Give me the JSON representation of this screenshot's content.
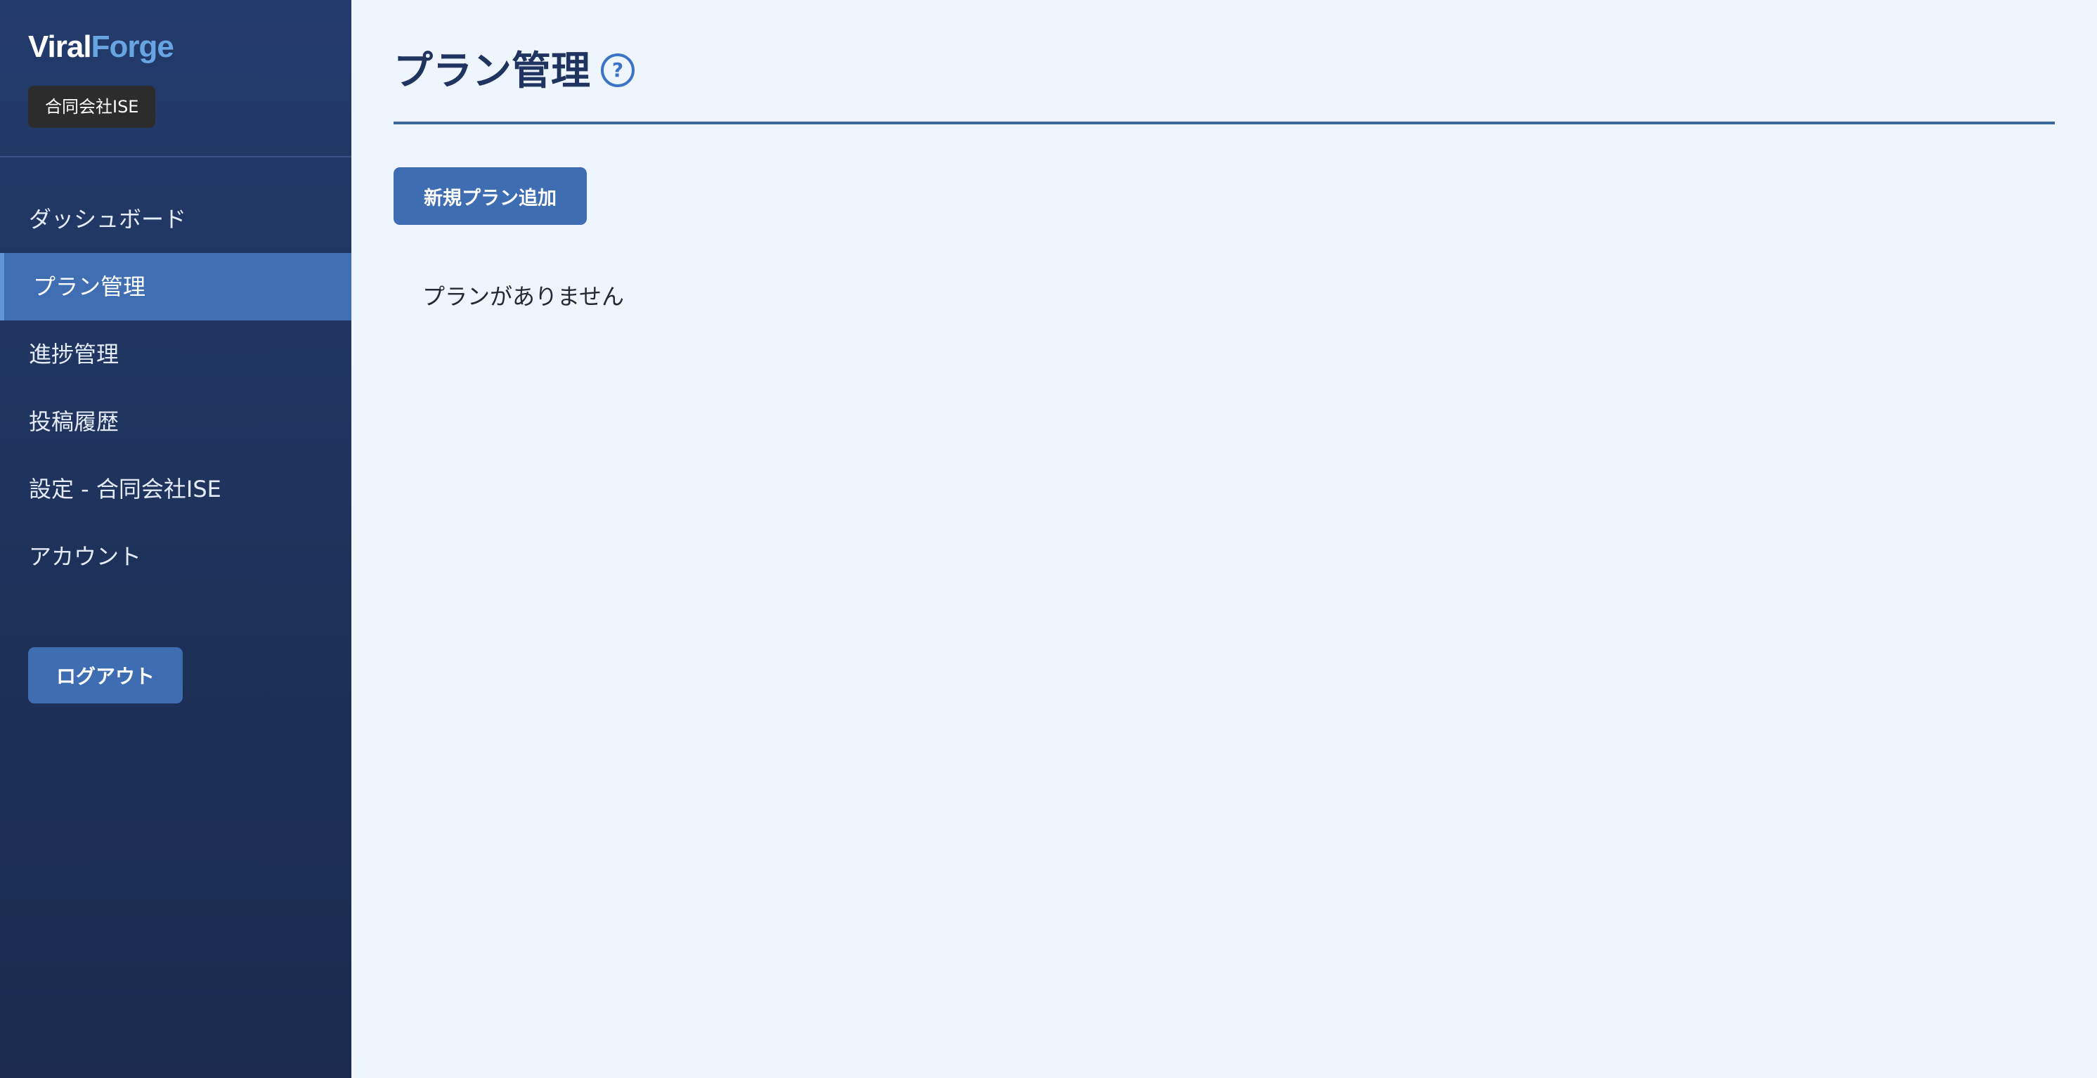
{
  "sidebar": {
    "brand_part1": "Viral",
    "brand_part2": "Forge",
    "company": "合同会社ISE",
    "items": [
      {
        "label": "ダッシュボード",
        "active": false
      },
      {
        "label": "プラン管理",
        "active": true
      },
      {
        "label": "進捗管理",
        "active": false
      },
      {
        "label": "投稿履歴",
        "active": false
      },
      {
        "label": "設定 - 合同会社ISE",
        "active": false
      },
      {
        "label": "アカウント",
        "active": false
      }
    ],
    "logout_label": "ログアウト"
  },
  "main": {
    "title": "プラン管理",
    "help_icon_glyph": "?",
    "add_button_label": "新規プラン追加",
    "empty_message": "プランがありません"
  },
  "colors": {
    "sidebar_bg": "#1d3259",
    "accent": "#3f6db1",
    "brand_highlight": "#68a4e2",
    "page_bg": "#eff5fc",
    "title_color": "#1f355f"
  }
}
